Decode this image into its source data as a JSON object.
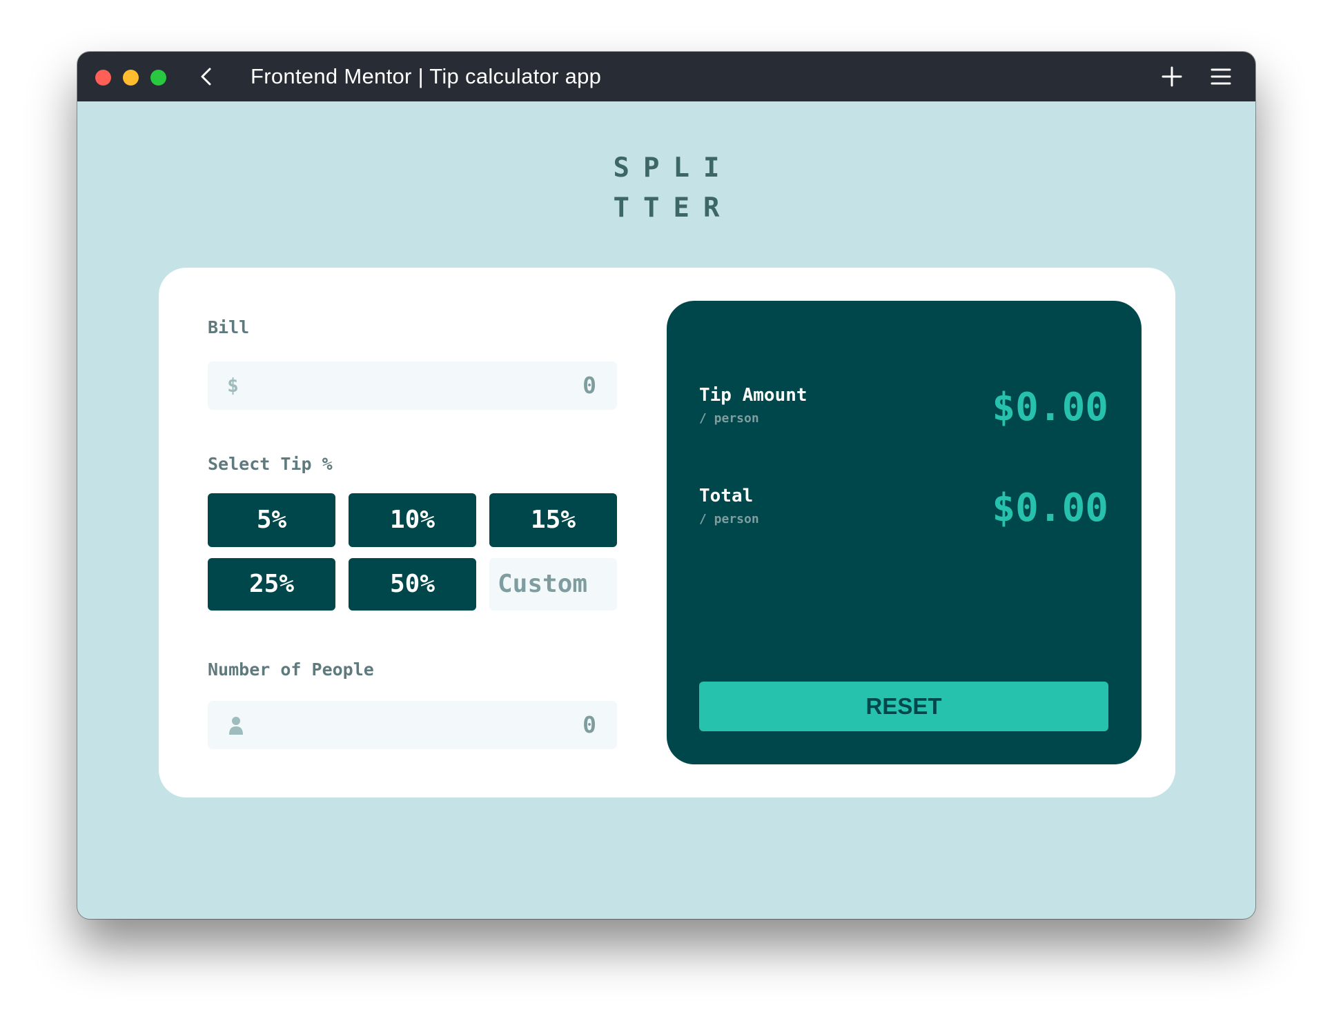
{
  "window": {
    "title": "Frontend Mentor | Tip calculator app"
  },
  "logo": {
    "line1": "SPLI",
    "line2": "TTER"
  },
  "bill": {
    "label": "Bill",
    "prefix": "$",
    "value": "0"
  },
  "tip": {
    "label": "Select Tip %",
    "options": [
      "5%",
      "10%",
      "15%",
      "25%",
      "50%"
    ],
    "custom_placeholder": "Custom"
  },
  "people": {
    "label": "Number of People",
    "value": "0"
  },
  "results": {
    "tip_amount_label": "Tip Amount",
    "tip_amount_sub": "/ person",
    "tip_amount_value": "$0.00",
    "total_label": "Total",
    "total_sub": "/ person",
    "total_value": "$0.00",
    "reset_label": "RESET"
  },
  "colors": {
    "background": "#c5e3e7",
    "dark_cyan": "#00474b",
    "strong_cyan": "#26c2ae",
    "titlebar": "#282c35"
  }
}
